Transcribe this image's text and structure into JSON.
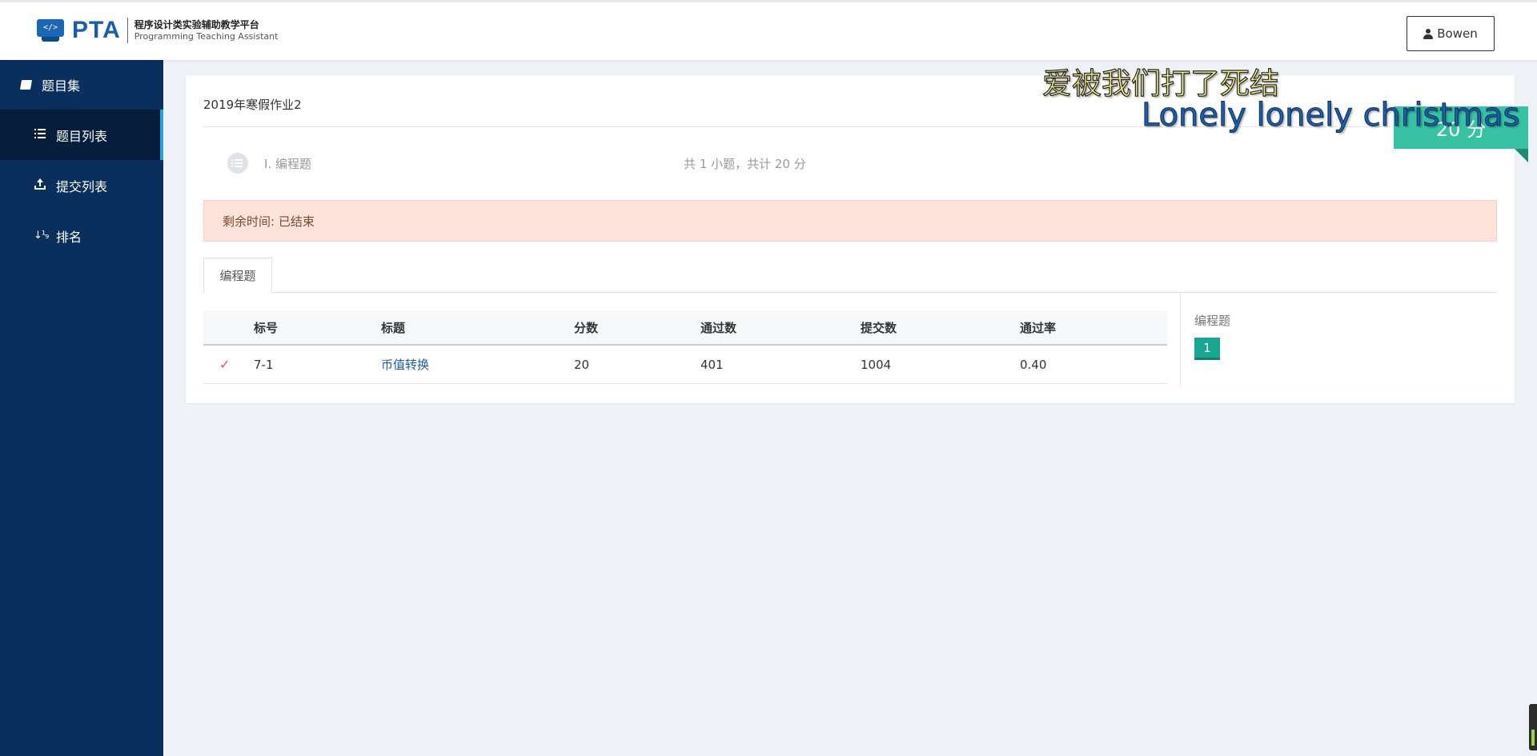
{
  "header": {
    "logo_text": "PTA",
    "logo_icon_text": "</>",
    "subtitle_cn": "程序设计类实验辅助教学平台",
    "subtitle_en": "Programming Teaching Assistant",
    "user_name": "Bowen"
  },
  "sidebar": {
    "title": "题目集",
    "items": [
      {
        "label": "题目列表",
        "icon": "list-icon",
        "active": true
      },
      {
        "label": "提交列表",
        "icon": "upload-icon",
        "active": false
      },
      {
        "label": "排名",
        "icon": "sort-icon",
        "active": false
      }
    ],
    "sort_icon_glyph": "↓¹₉"
  },
  "main": {
    "set_title": "2019年寒假作业2",
    "section": {
      "name": "I.  编程题",
      "summary": "共 1 小题，共计 20 分"
    },
    "time_alert": "剩余时间: 已结束",
    "tab_label": "编程题",
    "table": {
      "headers": [
        "",
        "标号",
        "标题",
        "分数",
        "通过数",
        "提交数",
        "通过率"
      ],
      "rows": [
        {
          "status": "✓",
          "id": "7-1",
          "title": "币值转换",
          "score": "20",
          "passed": "401",
          "submitted": "1004",
          "rate": "0.40"
        }
      ]
    },
    "side_panel": {
      "label": "编程题",
      "badge": "1"
    },
    "score_ribbon": "20 分"
  },
  "overlay": {
    "lyric_line1": "爱被我们打了死结",
    "lyric_line2": "Lonely lonely christmas"
  },
  "colors": {
    "sidebar_bg": "#0a2f5c",
    "accent_teal": "#36c2a3",
    "alert_bg": "#fde3d9",
    "link": "#1c5bb0"
  }
}
